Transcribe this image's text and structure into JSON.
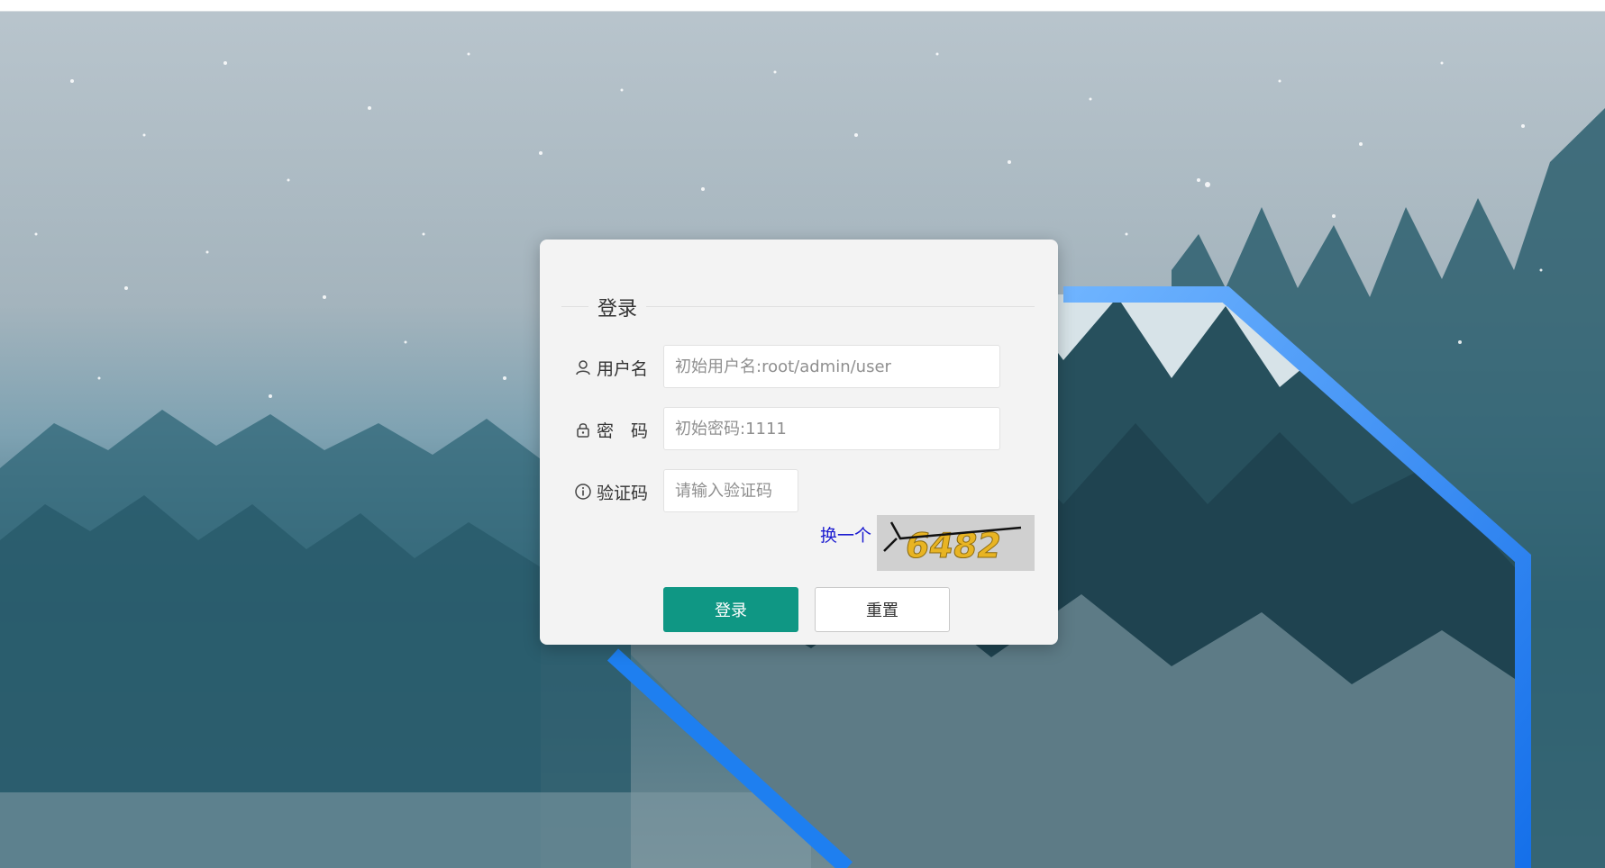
{
  "form": {
    "title": "登录",
    "username": {
      "label": "用户名",
      "placeholder": "初始用户名:root/admin/user"
    },
    "password": {
      "label": "密　码",
      "placeholder": "初始密码:1111"
    },
    "captcha": {
      "label": "验证码",
      "placeholder": "请输入验证码",
      "refresh_label": "换一个",
      "image_text": "6482"
    },
    "buttons": {
      "login_label": "登录",
      "reset_label": "重置"
    }
  },
  "colors": {
    "primary": "#0f9784",
    "link": "#1b1bd0",
    "frame_accent": "#1e7ff0"
  },
  "icons": {
    "username": "user-icon",
    "password": "lock-icon",
    "captcha": "info-icon"
  }
}
